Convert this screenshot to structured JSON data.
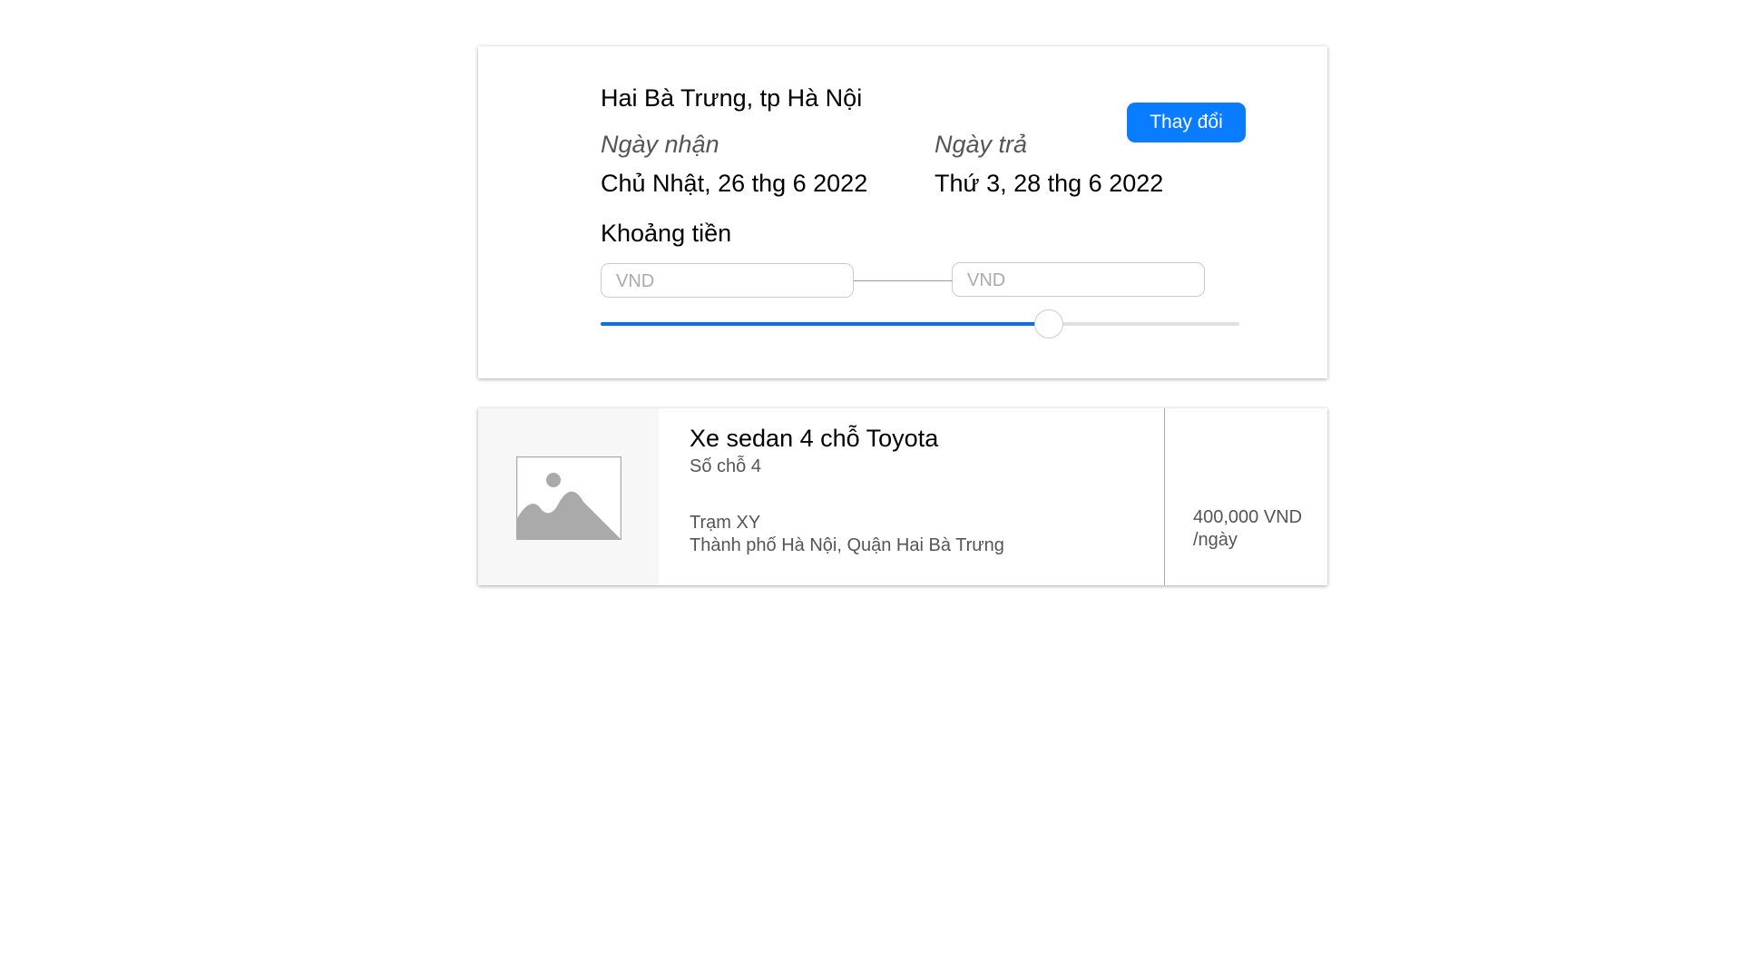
{
  "search": {
    "location": "Hai Bà Trưng, tp Hà Nội",
    "change_button": "Thay đổi",
    "pickup_label": "Ngày nhận",
    "pickup_date": "Chủ Nhật, 26 thg 6 2022",
    "return_label": "Ngày trả",
    "return_date": "Thứ 3, 28 thg 6 2022",
    "price_range_label": "Khoảng tiền",
    "min_placeholder": "VND",
    "max_placeholder": "VND",
    "slider_fraction": 0.7
  },
  "results": [
    {
      "title": "Xe sedan 4 chỗ Toyota",
      "seats": "Số chỗ 4",
      "station": "Trạm XY",
      "address": "Thành phố Hà Nội, Quận Hai Bà Trưng",
      "price": "400,000 VND",
      "unit": "/ngày",
      "image_icon": "image-placeholder-icon"
    }
  ]
}
